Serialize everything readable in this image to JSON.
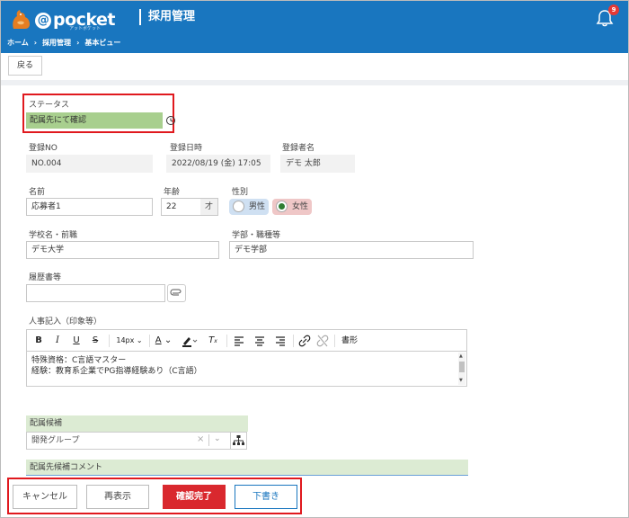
{
  "header": {
    "logo_text": "pocket",
    "logo_at": "@",
    "logo_sub": "アットポケット",
    "title": "採用管理",
    "notification_count": "9"
  },
  "breadcrumb": [
    "ホーム",
    "採用管理",
    "基本ビュー"
  ],
  "toolbar": {
    "back_label": "戻る"
  },
  "status": {
    "label": "ステータス",
    "value": "配属先にて確認",
    "color": "#a8cf8e"
  },
  "registration": {
    "no_label": "登録NO",
    "no_value": "NO.004",
    "date_label": "登録日時",
    "date_value": "2022/08/19 (金) 17:05",
    "registrant_label": "登録者名",
    "registrant_value": "デモ 太郎"
  },
  "applicant": {
    "name_label": "名前",
    "name_value": "応募者1",
    "age_label": "年齢",
    "age_value": "22",
    "age_unit": "才",
    "gender_label": "性別",
    "male_label": "男性",
    "female_label": "女性",
    "selected": "女性"
  },
  "school": {
    "school_label": "学校名・前職",
    "school_value": "デモ大学",
    "faculty_label": "学部・職種等",
    "faculty_value": "デモ学部"
  },
  "resume": {
    "label": "履歴書等",
    "value": ""
  },
  "hr_note": {
    "label": "人事記入（印象等）",
    "font_size": "14px",
    "format_label": "書形",
    "lines": [
      "特殊資格：C言語マスター",
      "経験：教育系企業でPG指導経験あり（C言語）"
    ]
  },
  "assignment": {
    "candidate_label": "配属候補",
    "candidate_value": "開発グループ",
    "comment_label": "配属先候補コメント"
  },
  "footer": {
    "cancel_label": "キャンセル",
    "redisplay_label": "再表示",
    "confirm_label": "確認完了",
    "draft_label": "下書き"
  },
  "colors": {
    "header": "#1976bf",
    "accent_red": "#d9282e",
    "status_green": "#a8cf8e",
    "section_green": "#dcebd3"
  }
}
